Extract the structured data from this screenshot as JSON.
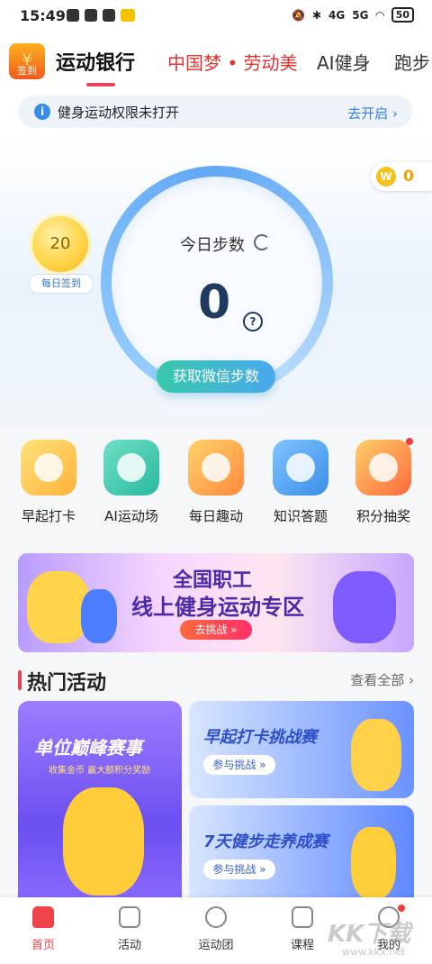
{
  "status_bar": {
    "time": "15:49",
    "network_a": "4G",
    "network_b": "5G",
    "battery": "50"
  },
  "top_nav": {
    "logo_text": "签到",
    "tabs": [
      {
        "label": "运动银行",
        "active": true
      },
      {
        "label": "中国梦 • 劳动美",
        "active": false
      },
      {
        "label": "AI健身",
        "active": false
      },
      {
        "label": "跑步",
        "active": false
      }
    ]
  },
  "notice": {
    "text": "健身运动权限未打开",
    "link": "去开启"
  },
  "coins": {
    "icon_letter": "W",
    "count": "0"
  },
  "checkin": {
    "day": "20",
    "label": "每日签到"
  },
  "steps": {
    "title": "今日步数",
    "count": "0",
    "help": "?",
    "button": "获取微信步数"
  },
  "quick_entries": [
    {
      "label": "早起打卡",
      "icon": "alarm-clock-icon"
    },
    {
      "label": "AI运动场",
      "icon": "ai-headphones-icon"
    },
    {
      "label": "每日趣动",
      "icon": "target-icon"
    },
    {
      "label": "知识答题",
      "icon": "quiz-notes-icon"
    },
    {
      "label": "积分抽奖",
      "icon": "lottery-wheel-icon",
      "badge": true
    }
  ],
  "banner": {
    "line1": "全国职工",
    "line2": "线上健身运动专区",
    "button": "去挑战 »"
  },
  "hot_section": {
    "title": "热门活动",
    "more": "查看全部"
  },
  "activities": {
    "big": {
      "title": "单位巅峰赛事",
      "subtitle": "收集金币 赢大额积分奖励"
    },
    "card1": {
      "title": "早起打卡挑战赛",
      "button": "参与挑战 »"
    },
    "card2": {
      "title": "7天健步走养成赛",
      "button": "参与挑战 »"
    }
  },
  "bottom_nav": [
    {
      "label": "首页",
      "active": true
    },
    {
      "label": "活动",
      "active": false
    },
    {
      "label": "运动团",
      "active": false
    },
    {
      "label": "课程",
      "active": false
    },
    {
      "label": "我的",
      "active": false
    }
  ],
  "watermark": {
    "main": "KK下载",
    "sub": "www.kkx.net"
  }
}
